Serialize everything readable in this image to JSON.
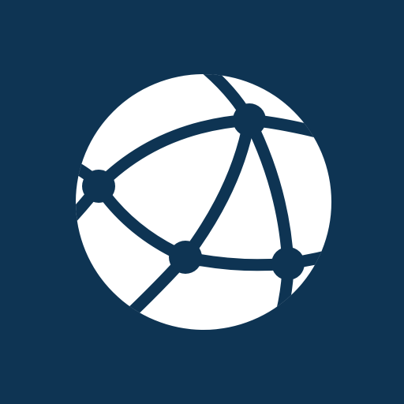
{
  "icon": {
    "name": "network-globe-icon",
    "background_color": "#0e3453",
    "foreground_color": "#ffffff"
  }
}
